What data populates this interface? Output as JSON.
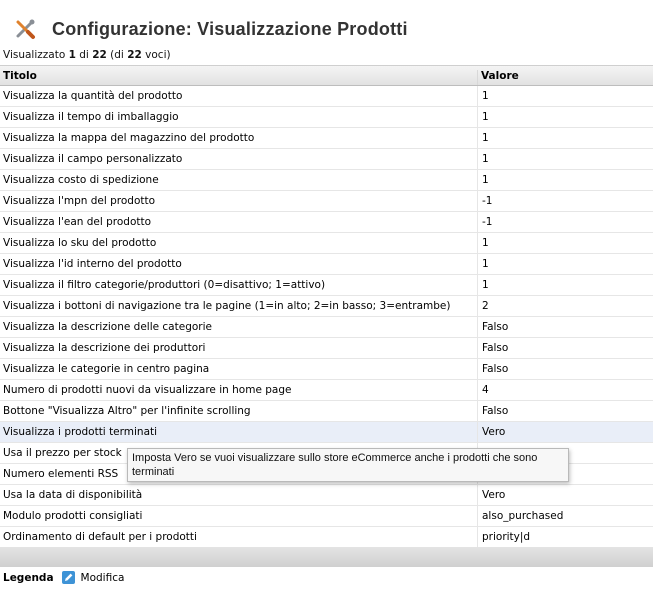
{
  "header": {
    "title": "Configurazione: Visualizzazione Prodotti",
    "icon": "tools-icon"
  },
  "summary": {
    "prefix": "Visualizzato",
    "from": "1",
    "sep": "di",
    "to": "22",
    "total_open": "(di",
    "total": "22",
    "total_close": "voci)"
  },
  "table": {
    "headers": {
      "title": "Titolo",
      "value": "Valore"
    },
    "rows": [
      {
        "title": "Visualizza la quantità del prodotto",
        "value": "1"
      },
      {
        "title": "Visualizza il tempo di imballaggio",
        "value": "1"
      },
      {
        "title": "Visualizza la mappa del magazzino del prodotto",
        "value": "1"
      },
      {
        "title": "Visualizza il campo personalizzato",
        "value": "1"
      },
      {
        "title": "Visualizza costo di spedizione",
        "value": "1"
      },
      {
        "title": "Visualizza l'mpn del prodotto",
        "value": "-1"
      },
      {
        "title": "Visualizza l'ean del prodotto",
        "value": "-1"
      },
      {
        "title": "Visualizza lo sku del prodotto",
        "value": "1"
      },
      {
        "title": "Visualizza l'id interno del prodotto",
        "value": "1"
      },
      {
        "title": "Visualizza il filtro categorie/produttori (0=disattivo; 1=attivo)",
        "value": "1"
      },
      {
        "title": "Visualizza i bottoni di navigazione tra le pagine (1=in alto; 2=in basso; 3=entrambe)",
        "value": "2"
      },
      {
        "title": "Visualizza la descrizione delle categorie",
        "value": "Falso"
      },
      {
        "title": "Visualizza la descrizione dei produttori",
        "value": "Falso"
      },
      {
        "title": "Visualizza le categorie in centro pagina",
        "value": "Falso"
      },
      {
        "title": "Numero di prodotti nuovi da visualizzare in home page",
        "value": "4"
      },
      {
        "title": "Bottone \"Visualizza Altro\" per l'infinite scrolling",
        "value": "Falso"
      },
      {
        "title": "Visualizza i prodotti terminati",
        "value": "Vero",
        "highlighted": true
      },
      {
        "title": "Usa il prezzo per stock",
        "value": ""
      },
      {
        "title": "Numero elementi RSS",
        "value": ""
      },
      {
        "title": "Usa la data di disponibilità",
        "value": "Vero"
      },
      {
        "title": "Modulo prodotti consigliati",
        "value": "also_purchased"
      },
      {
        "title": "Ordinamento di default per i prodotti",
        "value": "priority|d"
      }
    ]
  },
  "tooltip": {
    "text": "Imposta Vero se vuoi visualizzare sullo store eCommerce anche i prodotti che sono terminati"
  },
  "legend": {
    "label": "Legenda",
    "edit_label": "Modifica",
    "edit_icon": "edit-icon"
  }
}
